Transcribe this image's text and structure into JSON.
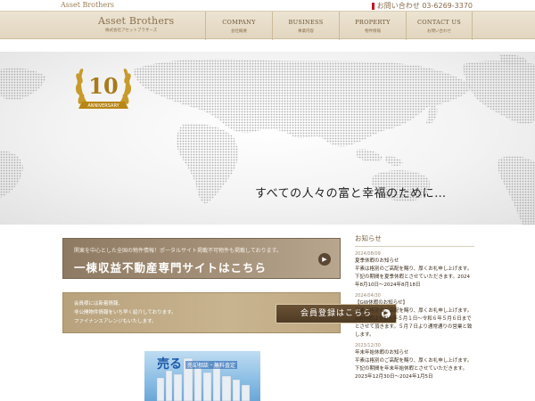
{
  "topbar": {
    "brand": "Asset Brothers",
    "phone_label": "お問い合わせ 03-6269-3370"
  },
  "header": {
    "logo_main": "Asset Brothers",
    "logo_sub": "株式会社アセットブラザーズ",
    "nav": [
      {
        "en": "COMPANY",
        "jp": "会社概要"
      },
      {
        "en": "BUSINESS",
        "jp": "事業内容"
      },
      {
        "en": "PROPERTY",
        "jp": "物件情報"
      },
      {
        "en": "CONTACT US",
        "jp": "お問い合わせ"
      }
    ]
  },
  "hero": {
    "badge_number": "10",
    "badge_text": "ANNIVERSARY",
    "tagline": "すべての人々の富と幸福のために…"
  },
  "banners": {
    "site_small": "関東を中心とした全国の物件情報！ポータルサイト掲載不可物件も掲載しております。",
    "site_big": "一棟収益不動産専門サイトはこちら",
    "member_lines": [
      "会員様には新着情報、",
      "非公開物件情報をいち早く紹介しております。",
      "ファイナンスアレンジもいたします。"
    ],
    "member_button": "会員登録はこちら",
    "sell_main": "売る",
    "sell_sub": "売却相談・無料査定"
  },
  "news": {
    "title": "お知らせ",
    "items": [
      {
        "date": "2024/08/09",
        "head": "夏季休暇のお知らせ",
        "body": "平素は格別のご高配を賜り、厚くお礼申し上げます。下記の期間を夏季休暇とさせていただきます。2024年8月10日～2024年8月18日"
      },
      {
        "date": "2024/04/30",
        "head": "【GW休暇のお知らせ】",
        "body": "平素は格別のご高配を賜り、厚くお礼申し上げます。GW休暇は令和６年５月１日～令和６年５月６日までとさせて頂きます。５月７日より通常通りの営業と致します。"
      },
      {
        "date": "2023/12/30",
        "head": "年末年始休暇のお知らせ",
        "body": "平素は格別のご高配を賜り、厚くお礼申し上げます。下記の期間を年末年始休暇とさせていただきます。2023年12月30日～2024年1月5日"
      }
    ]
  }
}
